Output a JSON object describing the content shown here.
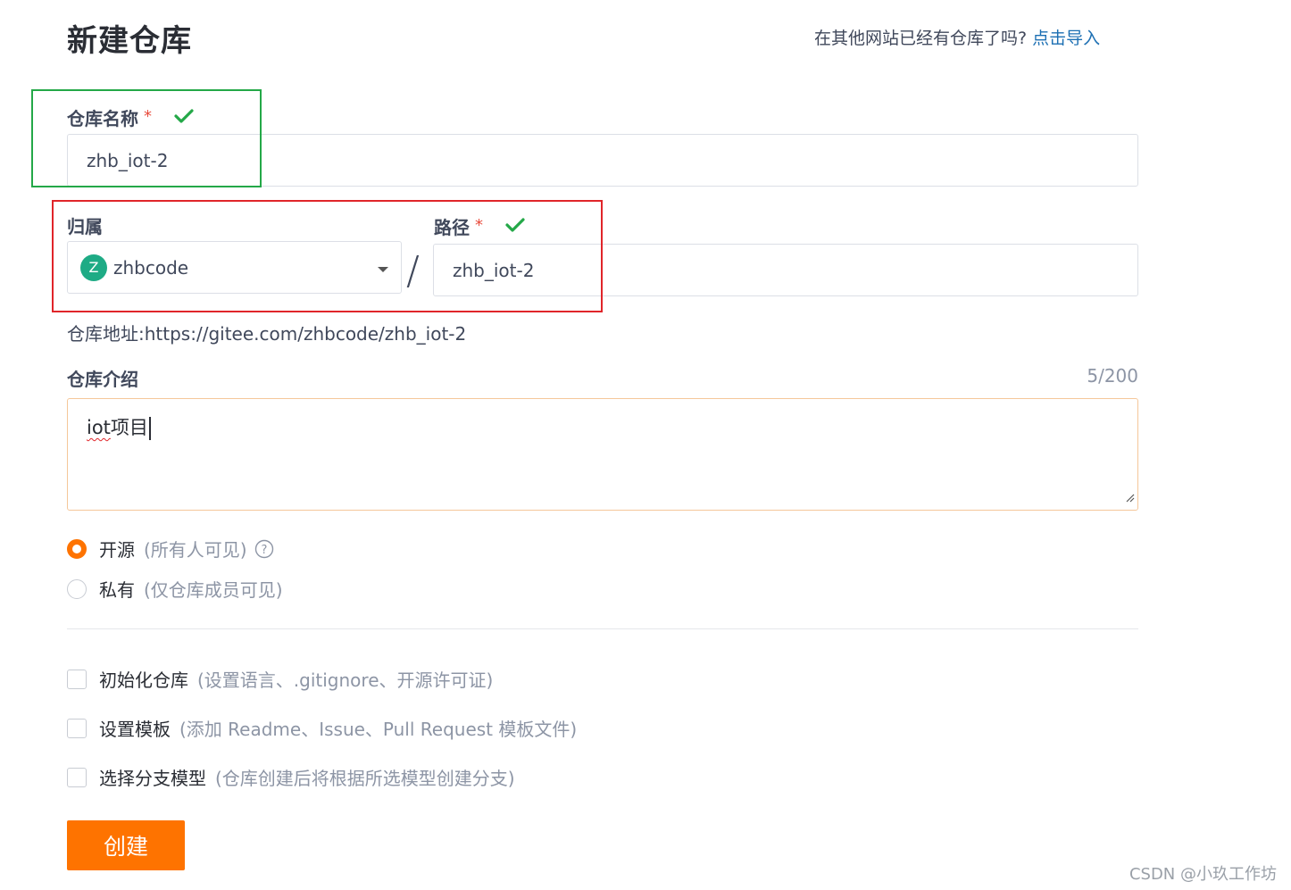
{
  "header": {
    "title": "新建仓库",
    "import_question": "在其他网站已经有仓库了吗?",
    "import_link": "点击导入"
  },
  "repo_name": {
    "label": "仓库名称",
    "required_mark": "*",
    "value": "zhb_iot-2"
  },
  "owner": {
    "label": "归属",
    "avatar_letter": "Z",
    "value": "zhbcode"
  },
  "separator": "/",
  "path": {
    "label": "路径",
    "required_mark": "*",
    "value": "zhb_iot-2"
  },
  "address": {
    "label": "仓库地址:",
    "url": "https://gitee.com/zhbcode/zhb_iot-2"
  },
  "intro": {
    "label": "仓库介绍",
    "counter": "5/200",
    "value_underlined": "iot",
    "value_rest": "项目"
  },
  "visibility": {
    "options": [
      {
        "label": "开源",
        "hint": "(所有人可见)",
        "selected": true
      },
      {
        "label": "私有",
        "hint": "(仅仓库成员可见)",
        "selected": false
      }
    ]
  },
  "options": [
    {
      "label": "初始化仓库",
      "hint": "(设置语言、.gitignore、开源许可证)",
      "checked": false
    },
    {
      "label": "设置模板",
      "hint": "(添加 Readme、Issue、Pull Request 模板文件)",
      "checked": false
    },
    {
      "label": "选择分支模型",
      "hint": "(仓库创建后将根据所选模型创建分支)",
      "checked": false
    }
  ],
  "submit_label": "创建",
  "watermark": "CSDN @小玖工作坊",
  "colors": {
    "accent": "#fe7300",
    "link": "#1c6fb3",
    "valid": "#24a848",
    "highlight_green": "#24a848",
    "highlight_red": "#e0252a"
  },
  "icons": {
    "valid": "check-icon",
    "dropdown": "caret-down-icon",
    "help": "question-circle-icon",
    "resize": "resize-handle-icon"
  }
}
